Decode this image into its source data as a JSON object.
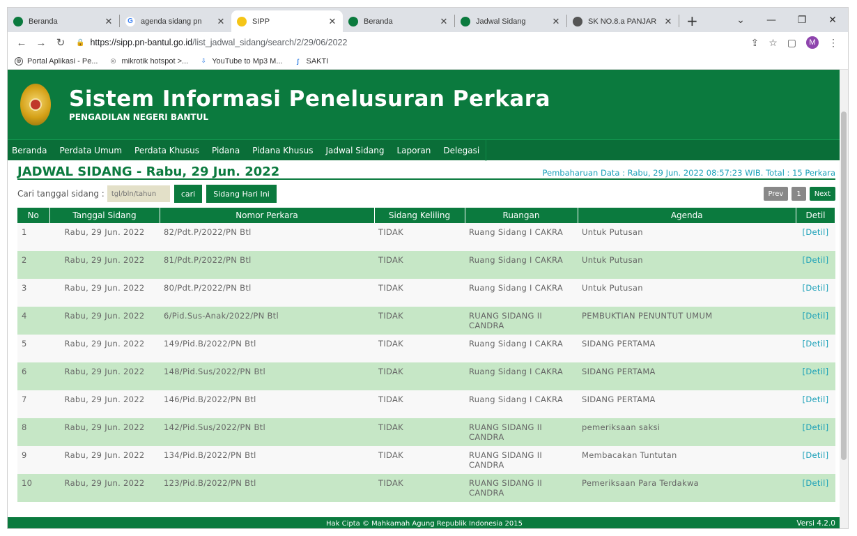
{
  "browser": {
    "tabs": [
      {
        "label": "Beranda",
        "icon_color": "#0b7a3e"
      },
      {
        "label": "agenda sidang pn",
        "icon_color": "#4285f4"
      },
      {
        "label": "SIPP",
        "icon_color": "#f5c518"
      },
      {
        "label": "Beranda",
        "icon_color": "#0b7a3e"
      },
      {
        "label": "Jadwal Sidang",
        "icon_color": "#0b7a3e"
      },
      {
        "label": "SK NO.8.a PANJAR",
        "icon_color": "#555555"
      }
    ],
    "url_host": "https://sipp.pn-bantul.go.id",
    "url_path": "/list_jadwal_sidang/search/2/29/06/2022",
    "avatar_letter": "M",
    "bookmarks": [
      {
        "label": "Portal Aplikasi - Pe..."
      },
      {
        "label": "mikrotik hotspot >..."
      },
      {
        "label": "YouTube to Mp3 M..."
      },
      {
        "label": "SAKTI"
      }
    ]
  },
  "site": {
    "title": "Sistem Informasi Penelusuran Perkara",
    "subtitle": "PENGADILAN NEGERI BANTUL"
  },
  "menu": [
    "Beranda",
    "Perdata Umum",
    "Perdata Khusus",
    "Pidana",
    "Pidana Khusus",
    "Jadwal Sidang",
    "Laporan",
    "Delegasi"
  ],
  "page": {
    "title": "JADWAL SIDANG - Rabu, 29 Jun. 2022",
    "update": "Pembaharuan Data : Rabu, 29 Jun. 2022 08:57:23 WIB. Total : 15 Perkara",
    "search_label": "Cari tanggal sidang :",
    "search_placeholder": "tgl/bln/tahun",
    "search_button": "cari",
    "today_button": "Sidang Hari Ini",
    "prev": "Prev",
    "page_num": "1",
    "next": "Next"
  },
  "table": {
    "headers": [
      "No",
      "Tanggal Sidang",
      "Nomor Perkara",
      "Sidang Keliling",
      "Ruangan",
      "Agenda",
      "Detil"
    ],
    "rows": [
      {
        "no": "1",
        "tanggal": "Rabu, 29 Jun. 2022",
        "nomor": "82/Pdt.P/2022/PN Btl",
        "keliling": "TIDAK",
        "ruangan": "Ruang Sidang I CAKRA",
        "agenda": "Untuk Putusan",
        "detil": "[Detil]"
      },
      {
        "no": "2",
        "tanggal": "Rabu, 29 Jun. 2022",
        "nomor": "81/Pdt.P/2022/PN Btl",
        "keliling": "TIDAK",
        "ruangan": "Ruang Sidang I CAKRA",
        "agenda": "Untuk Putusan",
        "detil": "[Detil]"
      },
      {
        "no": "3",
        "tanggal": "Rabu, 29 Jun. 2022",
        "nomor": "80/Pdt.P/2022/PN Btl",
        "keliling": "TIDAK",
        "ruangan": "Ruang Sidang I CAKRA",
        "agenda": "Untuk Putusan",
        "detil": "[Detil]"
      },
      {
        "no": "4",
        "tanggal": "Rabu, 29 Jun. 2022",
        "nomor": "6/Pid.Sus-Anak/2022/PN Btl",
        "keliling": "TIDAK",
        "ruangan": "RUANG SIDANG II CANDRA",
        "agenda": "PEMBUKTIAN PENUNTUT UMUM",
        "detil": "[Detil]"
      },
      {
        "no": "5",
        "tanggal": "Rabu, 29 Jun. 2022",
        "nomor": "149/Pid.B/2022/PN Btl",
        "keliling": "TIDAK",
        "ruangan": "Ruang Sidang I CAKRA",
        "agenda": "SIDANG PERTAMA",
        "detil": "[Detil]"
      },
      {
        "no": "6",
        "tanggal": "Rabu, 29 Jun. 2022",
        "nomor": "148/Pid.Sus/2022/PN Btl",
        "keliling": "TIDAK",
        "ruangan": "Ruang Sidang I CAKRA",
        "agenda": "SIDANG PERTAMA",
        "detil": "[Detil]"
      },
      {
        "no": "7",
        "tanggal": "Rabu, 29 Jun. 2022",
        "nomor": "146/Pid.B/2022/PN Btl",
        "keliling": "TIDAK",
        "ruangan": "Ruang Sidang I CAKRA",
        "agenda": "SIDANG PERTAMA",
        "detil": "[Detil]"
      },
      {
        "no": "8",
        "tanggal": "Rabu, 29 Jun. 2022",
        "nomor": "142/Pid.Sus/2022/PN Btl",
        "keliling": "TIDAK",
        "ruangan": "RUANG SIDANG II CANDRA",
        "agenda": "pemeriksaan saksi",
        "detil": "[Detil]"
      },
      {
        "no": "9",
        "tanggal": "Rabu, 29 Jun. 2022",
        "nomor": "134/Pid.B/2022/PN Btl",
        "keliling": "TIDAK",
        "ruangan": "RUANG SIDANG II CANDRA",
        "agenda": "Membacakan Tuntutan",
        "detil": "[Detil]"
      },
      {
        "no": "10",
        "tanggal": "Rabu, 29 Jun. 2022",
        "nomor": "123/Pid.B/2022/PN Btl",
        "keliling": "TIDAK",
        "ruangan": "RUANG SIDANG II CANDRA",
        "agenda": "Pemeriksaan Para Terdakwa",
        "detil": "[Detil]"
      }
    ]
  },
  "footer": {
    "copyright": "Hak Cipta © Mahkamah Agung Republik Indonesia 2015",
    "version": "Versi 4.2.0"
  },
  "colors": {
    "brand_green": "#0b7a3e",
    "row_alt": "#c6e7c6",
    "link": "#1ba0b8"
  }
}
